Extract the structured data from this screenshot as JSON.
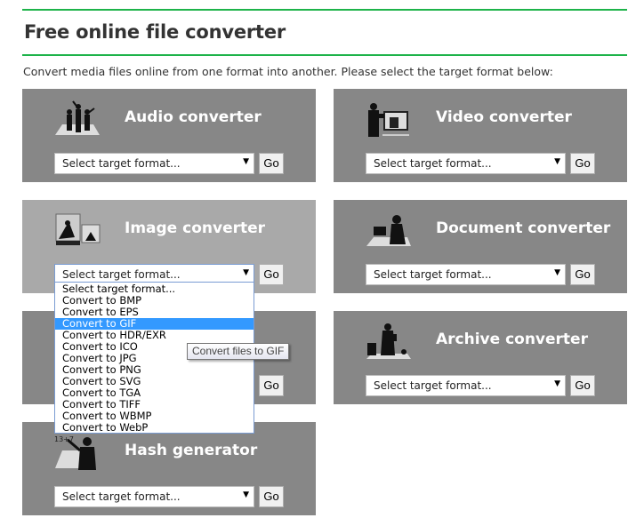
{
  "header": {
    "title": "Free online file converter",
    "intro": "Convert media files online from one format into another. Please select the target format below:"
  },
  "cards": [
    {
      "title": "Audio converter",
      "icon": "audio-dancers-icon",
      "select": "Select target format...",
      "go": "Go"
    },
    {
      "title": "Video converter",
      "icon": "video-camera-icon",
      "select": "Select target format...",
      "go": "Go"
    },
    {
      "title": "Image converter",
      "icon": "image-photo-icon",
      "select": "Select target format...",
      "go": "Go"
    },
    {
      "title": "Document converter",
      "icon": "document-desk-icon",
      "select": "Select target format...",
      "go": "Go"
    },
    {
      "title": "",
      "icon": "",
      "select": "",
      "go": "Go"
    },
    {
      "title": "Archive converter",
      "icon": "archive-box-icon",
      "select": "Select target format...",
      "go": "Go"
    },
    {
      "title": "Hash generator",
      "icon": "hash-writer-icon",
      "select": "Select target format...",
      "go": "Go"
    }
  ],
  "dropdown": {
    "options": [
      "Select target format...",
      "Convert to BMP",
      "Convert to EPS",
      "Convert to GIF",
      "Convert to HDR/EXR",
      "Convert to ICO",
      "Convert to JPG",
      "Convert to PNG",
      "Convert to SVG",
      "Convert to TGA",
      "Convert to TIFF",
      "Convert to WBMP",
      "Convert to WebP"
    ],
    "highlighted": "Convert to GIF"
  },
  "tooltip": "Convert files to GIF",
  "colors": {
    "accent": "#1db34a",
    "card": "#878787",
    "card_active": "#a9a9a9",
    "highlight": "#3399ff"
  }
}
